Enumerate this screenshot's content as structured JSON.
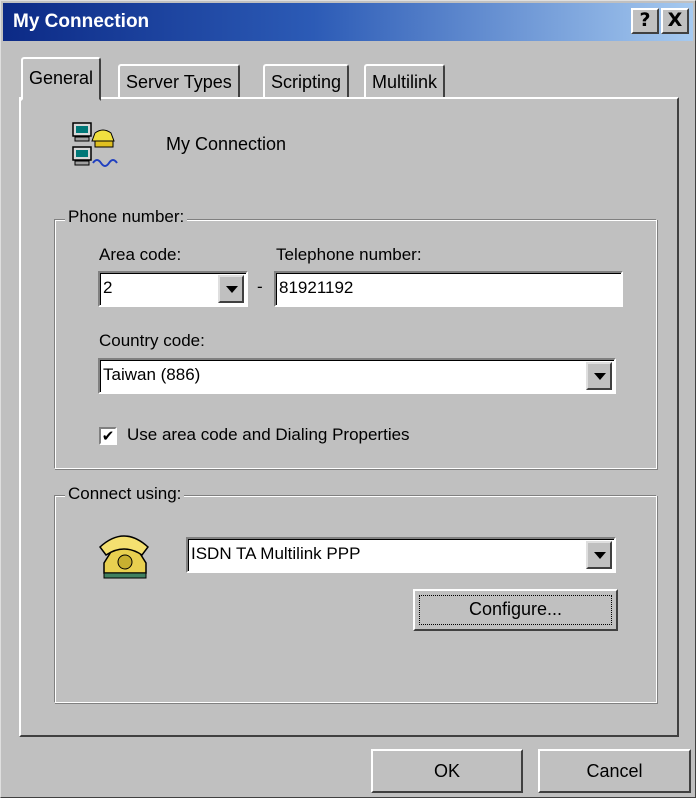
{
  "window": {
    "title": "My Connection",
    "help_glyph": "?",
    "close_glyph": "X"
  },
  "tabs": [
    {
      "label": "General",
      "active": true
    },
    {
      "label": "Server Types",
      "active": false
    },
    {
      "label": "Scripting",
      "active": false
    },
    {
      "label": "Multilink",
      "active": false
    }
  ],
  "connection": {
    "name": "My Connection",
    "icon": "network-computers-icon"
  },
  "phone": {
    "group_label": "Phone number:",
    "area_code_label": "Area code:",
    "area_code_value": "2",
    "separator": "-",
    "telephone_label": "Telephone number:",
    "telephone_value": "81921192",
    "country_label": "Country code:",
    "country_value": "Taiwan (886)",
    "use_dialing_label": "Use area code and Dialing Properties",
    "use_dialing_checked": true,
    "check_glyph": "✔"
  },
  "connect": {
    "group_label": "Connect using:",
    "device_value": "ISDN TA Multilink PPP",
    "device_icon": "telephone-icon",
    "configure_label": "Configure..."
  },
  "footer": {
    "ok_label": "OK",
    "cancel_label": "Cancel"
  },
  "colors": {
    "face": "#c0c0c0",
    "title_start": "#0c2a86",
    "title_end": "#a6caf0"
  }
}
